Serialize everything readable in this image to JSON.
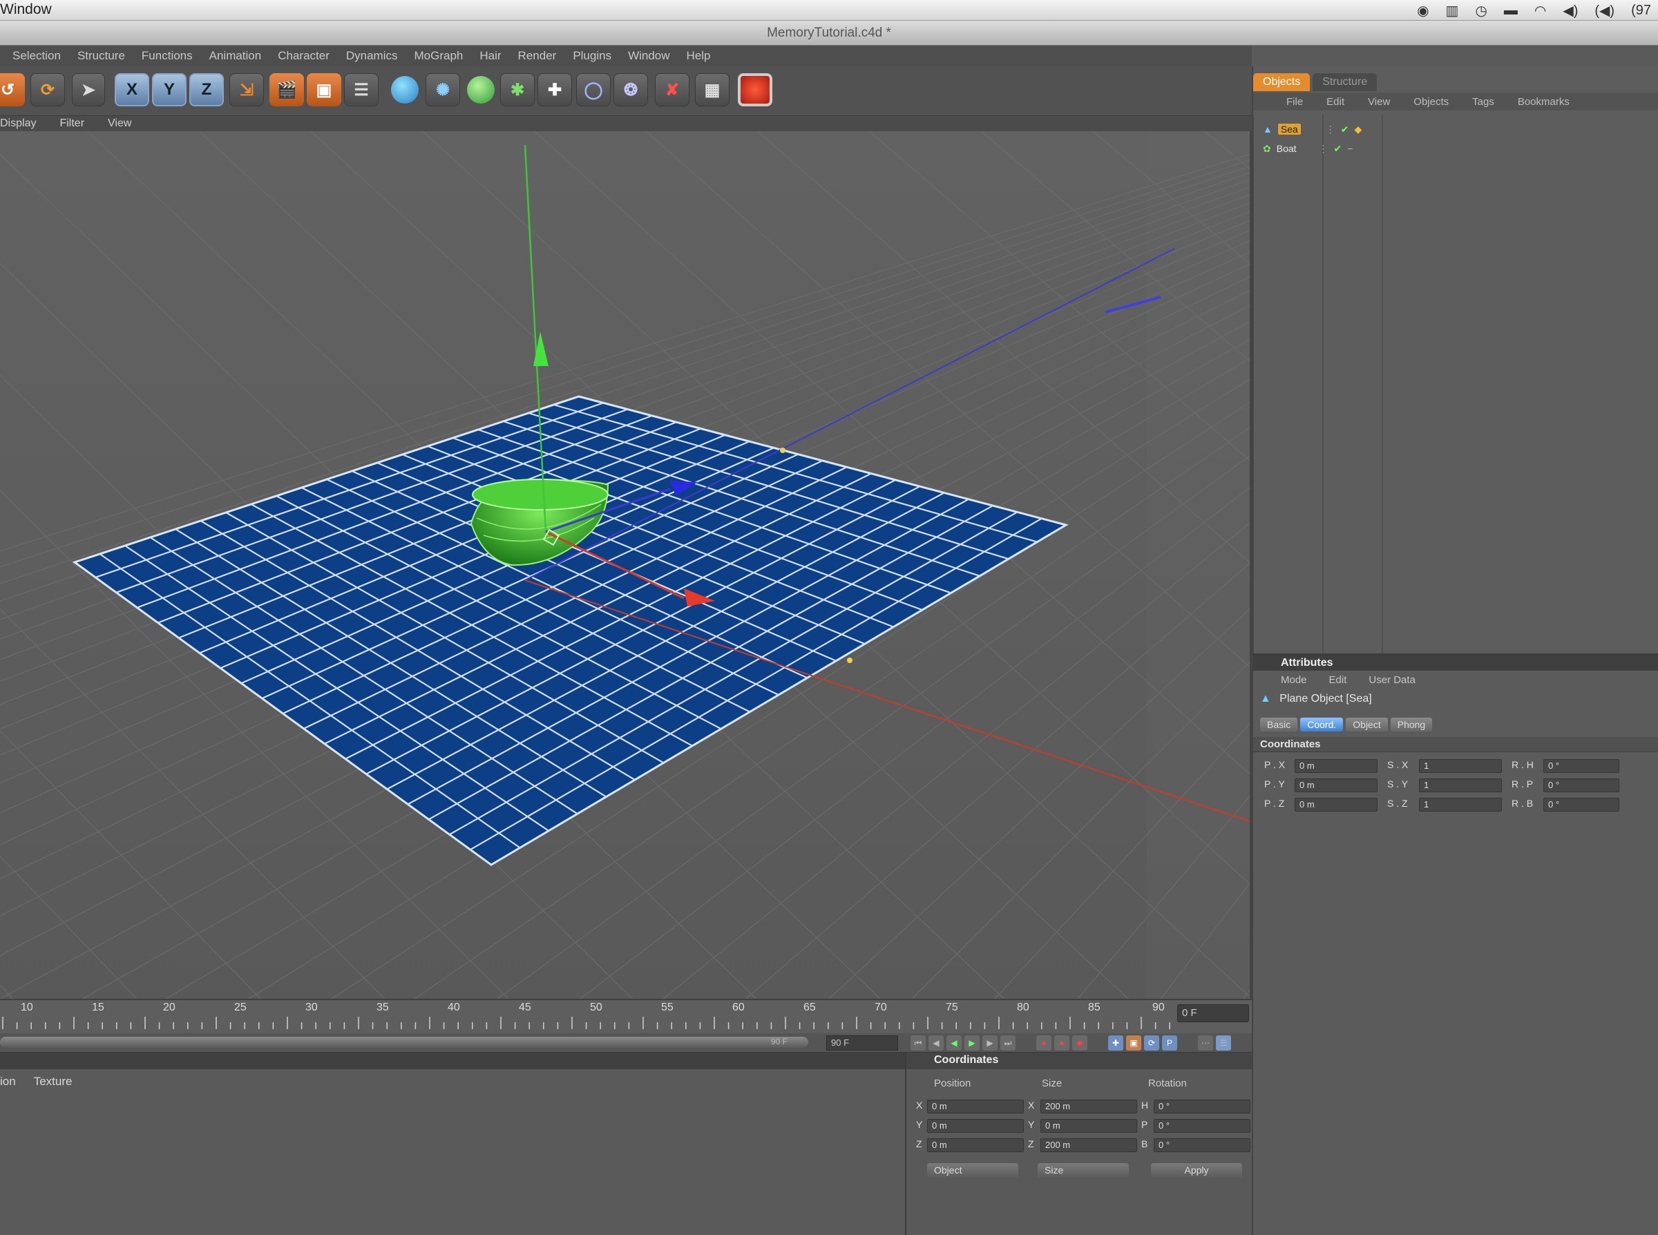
{
  "system_bar": {
    "app_menu": "Window",
    "tray": [
      "◉",
      "▥",
      "◷",
      "▬",
      "◠",
      "◀)",
      "(◀)",
      "(97"
    ]
  },
  "window": {
    "title": "MemoryTutorial.c4d *"
  },
  "menu": [
    "Selection",
    "Structure",
    "Functions",
    "Animation",
    "Character",
    "Dynamics",
    "MoGraph",
    "Hair",
    "Render",
    "Plugins",
    "Window",
    "Help"
  ],
  "toolbar": {
    "axis_x": "X",
    "axis_y": "Y",
    "axis_z": "Z"
  },
  "viewport": {
    "menu": [
      "Display",
      "Filter",
      "View"
    ]
  },
  "timeline": {
    "ticks": [
      "10",
      "15",
      "20",
      "25",
      "30",
      "35",
      "40",
      "45",
      "50",
      "55",
      "60",
      "65",
      "70",
      "75",
      "80",
      "85",
      "90"
    ],
    "current_frame": "0 F",
    "slider_end": "90 F",
    "end_frame": "90 F"
  },
  "material_manager": {
    "tabs": [
      "ion",
      "Texture"
    ]
  },
  "coordinates_manager": {
    "title": "Coordinates",
    "headers": {
      "position": "Position",
      "size": "Size",
      "rotation": "Rotation"
    },
    "rows": [
      {
        "axis": "X",
        "pos": "0 m",
        "size_axis": "X",
        "size": "200 m",
        "rot_axis": "H",
        "rot": "0 °"
      },
      {
        "axis": "Y",
        "pos": "0 m",
        "size_axis": "Y",
        "size": "0 m",
        "rot_axis": "P",
        "rot": "0 °"
      },
      {
        "axis": "Z",
        "pos": "0 m",
        "size_axis": "Z",
        "size": "200 m",
        "rot_axis": "B",
        "rot": "0 °"
      }
    ],
    "mode_dropdown": "Object",
    "size_dropdown": "Size",
    "apply_label": "Apply"
  },
  "object_manager": {
    "tabs": [
      "Objects",
      "Structure"
    ],
    "menu": [
      "File",
      "Edit",
      "View",
      "Objects",
      "Tags",
      "Bookmarks"
    ],
    "objects": [
      {
        "name": "Sea"
      },
      {
        "name": "Boat"
      }
    ]
  },
  "attributes": {
    "title": "Attributes",
    "menu": [
      "Mode",
      "Edit",
      "User Data"
    ],
    "object_name": "Plane Object [Sea]",
    "tabs": [
      "Basic",
      "Coord.",
      "Object",
      "Phong"
    ],
    "section": "Coordinates",
    "rows": [
      {
        "p_label": "P . X",
        "p": "0 m",
        "s_label": "S . X",
        "s": "1",
        "r_label": "R . H",
        "r": "0 °"
      },
      {
        "p_label": "P . Y",
        "p": "0 m",
        "s_label": "S . Y",
        "s": "1",
        "r_label": "R . P",
        "r": "0 °"
      },
      {
        "p_label": "P . Z",
        "p": "0 m",
        "s_label": "S . Z",
        "s": "1",
        "r_label": "R . B",
        "r": "0 °"
      }
    ]
  },
  "colors": {
    "accent": "#e38d2e",
    "plane": "#0d3f86",
    "boat": "#35b52d",
    "axis_x": "#d43a2a",
    "axis_y": "#3fc43a",
    "axis_z": "#3a3ad0"
  }
}
